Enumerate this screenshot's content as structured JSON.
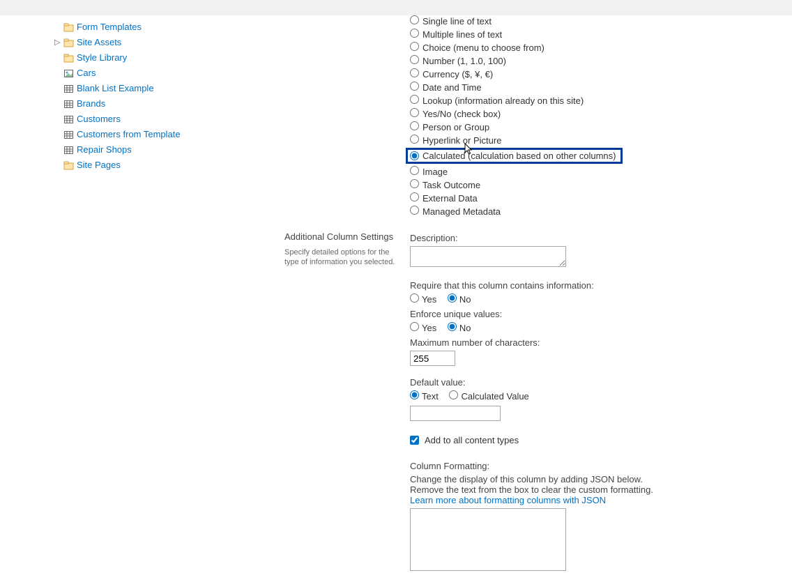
{
  "sidebar": {
    "items": [
      {
        "label": "Form Templates",
        "icon": "folder"
      },
      {
        "label": "Site Assets",
        "icon": "folder",
        "expandable": true
      },
      {
        "label": "Style Library",
        "icon": "folder"
      },
      {
        "label": "Cars",
        "icon": "image"
      },
      {
        "label": "Blank List Example",
        "icon": "list"
      },
      {
        "label": "Brands",
        "icon": "list"
      },
      {
        "label": "Customers",
        "icon": "list"
      },
      {
        "label": "Customers from Template",
        "icon": "list"
      },
      {
        "label": "Repair Shops",
        "icon": "list"
      },
      {
        "label": "Site Pages",
        "icon": "folder"
      }
    ]
  },
  "columnTypes": [
    {
      "label": "Single line of text"
    },
    {
      "label": "Multiple lines of text"
    },
    {
      "label": "Choice (menu to choose from)"
    },
    {
      "label": "Number (1, 1.0, 100)"
    },
    {
      "label": "Currency ($, ¥, €)"
    },
    {
      "label": "Date and Time"
    },
    {
      "label": "Lookup (information already on this site)"
    },
    {
      "label": "Yes/No (check box)"
    },
    {
      "label": "Person or Group"
    },
    {
      "label": "Hyperlink or Picture"
    },
    {
      "label": "Calculated (calculation based on other columns)",
      "selected": true,
      "highlighted": true
    },
    {
      "label": "Image"
    },
    {
      "label": "Task Outcome"
    },
    {
      "label": "External Data"
    },
    {
      "label": "Managed Metadata"
    }
  ],
  "additional": {
    "title": "Additional Column Settings",
    "subtitle": "Specify detailed options for the type of information you selected.",
    "descriptionLabel": "Description:",
    "requireLabel": "Require that this column contains information:",
    "require": {
      "yes": "Yes",
      "no": "No",
      "value": "no"
    },
    "uniqueLabel": "Enforce unique values:",
    "unique": {
      "yes": "Yes",
      "no": "No",
      "value": "no"
    },
    "maxCharsLabel": "Maximum number of characters:",
    "maxCharsValue": "255",
    "defaultLabel": "Default value:",
    "default": {
      "text": "Text",
      "calc": "Calculated Value",
      "value": "text"
    },
    "addToCTLabel": "Add to all content types",
    "addToCTChecked": true,
    "fmtTitle": "Column Formatting:",
    "fmtLine1": "Change the display of this column by adding JSON below.",
    "fmtLine2": "Remove the text from the box to clear the custom formatting.",
    "fmtLink": "Learn more about formatting columns with JSON"
  }
}
